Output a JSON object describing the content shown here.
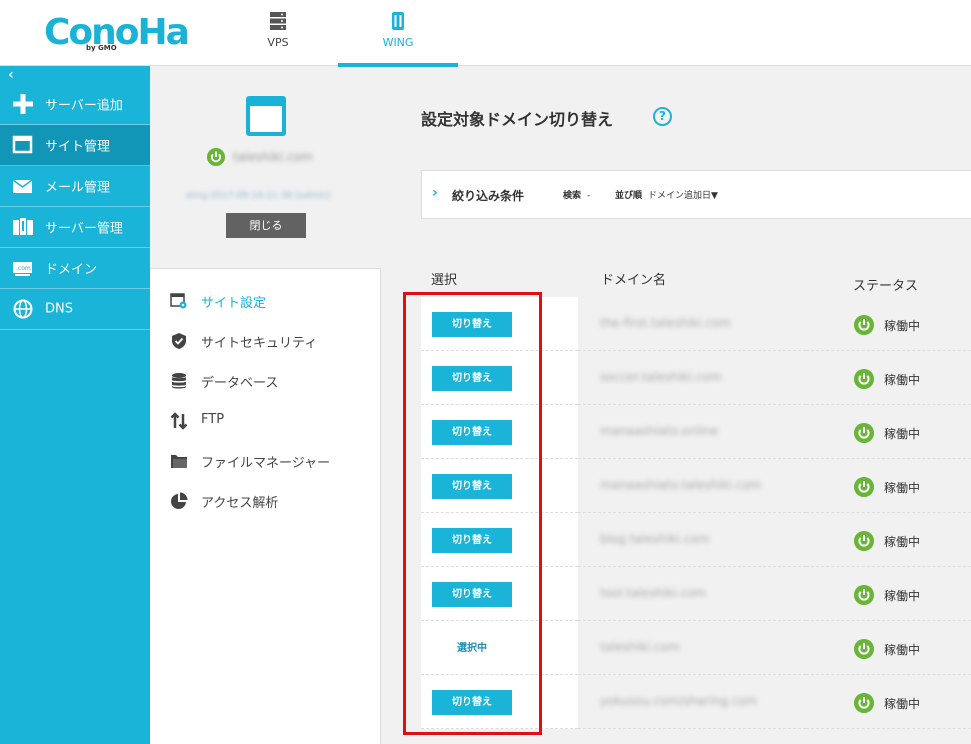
{
  "header": {
    "logo_text": "ConoHa",
    "logo_sub": "by GMO",
    "tabs": [
      {
        "label": "VPS",
        "icon": "server-icon"
      },
      {
        "label": "WING",
        "icon": "wing-icon",
        "active": true
      }
    ]
  },
  "sidebar": {
    "collapse": "‹",
    "items": [
      {
        "label": "サーバー追加",
        "icon": "plus-icon"
      },
      {
        "label": "サイト管理",
        "icon": "window-icon",
        "active": true
      },
      {
        "label": "メール管理",
        "icon": "mail-icon"
      },
      {
        "label": "サーバー管理",
        "icon": "server-manage-icon"
      },
      {
        "label": "ドメイン",
        "icon": "domain-icon"
      },
      {
        "label": "DNS",
        "icon": "globe-icon"
      }
    ]
  },
  "site": {
    "name": "taleshiki.com",
    "sub": "wing-2017-09-14-11-38 [admin]",
    "close_label": "閉じる"
  },
  "submenu": [
    {
      "label": "サイト設定",
      "icon": "site-settings-icon",
      "active": true
    },
    {
      "label": "サイトセキュリティ",
      "icon": "shield-icon"
    },
    {
      "label": "データベース",
      "icon": "database-icon"
    },
    {
      "label": "FTP",
      "icon": "ftp-icon"
    },
    {
      "label": "ファイルマネージャー",
      "icon": "folder-icon"
    },
    {
      "label": "アクセス解析",
      "icon": "pie-chart-icon"
    }
  ],
  "main": {
    "title": "設定対象ドメイン切り替え",
    "help": "?",
    "filter": {
      "chevron": "›",
      "title": "絞り込み条件",
      "search_label": "検索",
      "search_value": "-",
      "sort_label": "並び順",
      "sort_value": "ドメイン追加日▼"
    },
    "columns": {
      "select": "選択",
      "domain": "ドメイン名",
      "status": "ステータス"
    },
    "rows": [
      {
        "action": "切り替え",
        "domain": "the-first.taleshiki.com",
        "status": "稼働中",
        "selected": false
      },
      {
        "action": "切り替え",
        "domain": "soccer.taleshiki.com",
        "status": "稼働中",
        "selected": false
      },
      {
        "action": "切り替え",
        "domain": "manaashiato.online",
        "status": "稼働中",
        "selected": false
      },
      {
        "action": "切り替え",
        "domain": "manaashiato.taleshiki.com",
        "status": "稼働中",
        "selected": false
      },
      {
        "action": "切り替え",
        "domain": "blog.taleshiki.com",
        "status": "稼働中",
        "selected": false
      },
      {
        "action": "切り替え",
        "domain": "tool.taleshiki.com",
        "status": "稼働中",
        "selected": false
      },
      {
        "action": "選択中",
        "domain": "taleshiki.com",
        "status": "稼働中",
        "selected": true
      },
      {
        "action": "切り替え",
        "domain": "yokusou.com/sharing.com",
        "status": "稼働中",
        "selected": false
      }
    ]
  },
  "colors": {
    "accent": "#19b4d7",
    "active_nav": "#1296b7",
    "status_green": "#69b538",
    "highlight_red": "#e01010",
    "close_button": "#626262"
  }
}
